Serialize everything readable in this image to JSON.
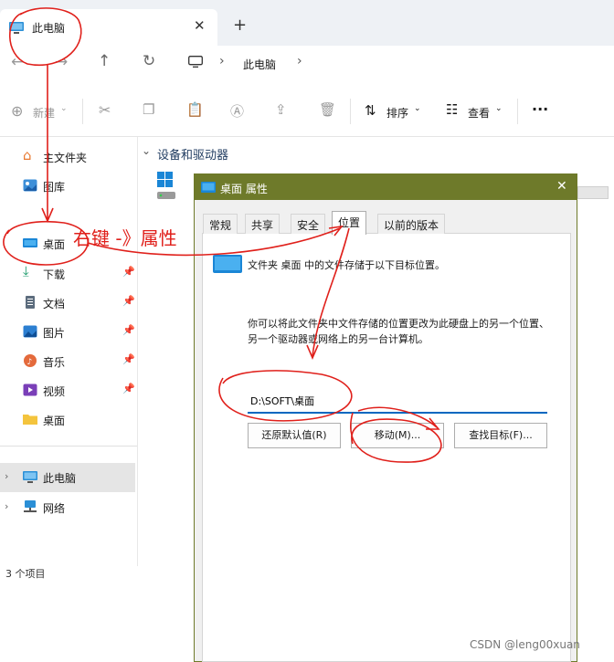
{
  "tab": {
    "title": "此电脑",
    "close": "✕",
    "new_tab": "+"
  },
  "address": {
    "crumb": "此电脑"
  },
  "toolbar": {
    "new_label": "新建",
    "sort_label": "排序",
    "view_label": "查看",
    "more": "···"
  },
  "sidebar": {
    "items": [
      {
        "label": "主文件夹"
      },
      {
        "label": "图库"
      },
      {
        "label": "桌面"
      },
      {
        "label": "下载"
      },
      {
        "label": "文档"
      },
      {
        "label": "图片"
      },
      {
        "label": "音乐"
      },
      {
        "label": "视频"
      },
      {
        "label": "桌面"
      },
      {
        "label": "此电脑"
      },
      {
        "label": "网络"
      }
    ]
  },
  "main": {
    "group_title": "设备和驱动器"
  },
  "status": {
    "count": "3 个项目"
  },
  "dialog": {
    "title": "桌面 属性",
    "tabs": [
      "常规",
      "共享",
      "安全",
      "位置",
      "以前的版本"
    ],
    "desc1": "文件夹 桌面 中的文件存储于以下目标位置。",
    "desc2": "你可以将此文件夹中文件存储的位置更改为此硬盘上的另一个位置、另一个驱动器或网络上的另一台计算机。",
    "path_value": "D:\\SOFT\\桌面",
    "btn_restore": "还原默认值(R)",
    "btn_move": "移动(M)...",
    "btn_find": "查找目标(F)..."
  },
  "annotation": {
    "text": "右键 -》属性",
    "color": "#e0201b"
  },
  "watermark": "CSDN @leng00xuan"
}
